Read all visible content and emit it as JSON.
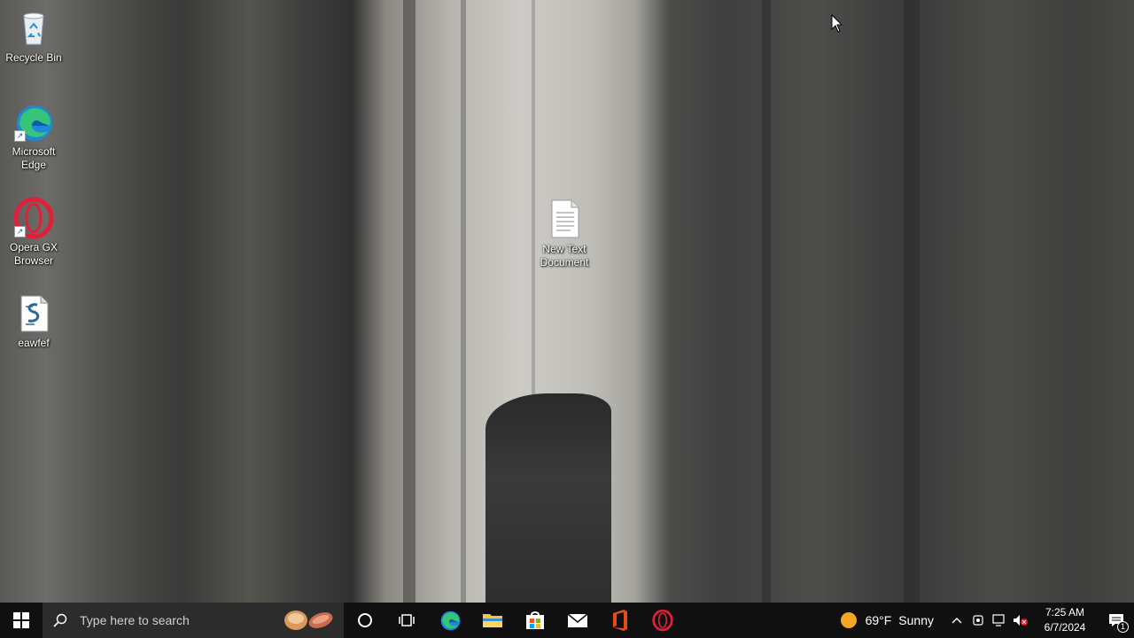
{
  "desktop": {
    "icons": [
      {
        "label": "Recycle Bin",
        "icon": "recycle-bin-icon"
      },
      {
        "label": "Microsoft Edge",
        "icon": "edge-icon"
      },
      {
        "label": "Opera GX Browser",
        "icon": "opera-gx-icon"
      },
      {
        "label": "eawfef",
        "icon": "script-file-icon"
      },
      {
        "label": "New Text Document",
        "icon": "text-document-icon"
      }
    ]
  },
  "taskbar": {
    "start_icon": "windows-start-icon",
    "search_placeholder": "Type here to search",
    "pinned": [
      {
        "name": "cortana",
        "icon": "cortana-circle-icon"
      },
      {
        "name": "task-view",
        "icon": "task-view-icon"
      },
      {
        "name": "edge",
        "icon": "edge-icon"
      },
      {
        "name": "file-explorer",
        "icon": "folder-icon"
      },
      {
        "name": "microsoft-store",
        "icon": "store-bag-icon"
      },
      {
        "name": "mail",
        "icon": "mail-icon"
      },
      {
        "name": "office",
        "icon": "office-icon"
      },
      {
        "name": "opera-gx",
        "icon": "opera-gx-icon"
      }
    ],
    "weather": {
      "temp": "69°F",
      "condition": "Sunny"
    },
    "clock": {
      "time": "7:25 AM",
      "date": "6/7/2024"
    },
    "notification_count": "1"
  },
  "colors": {
    "taskbar_bg": "#101010",
    "search_bg": "#2c2c2c",
    "sun": "#f5a623",
    "opera_red": "#e0203a",
    "office_orange": "#e64a19"
  }
}
